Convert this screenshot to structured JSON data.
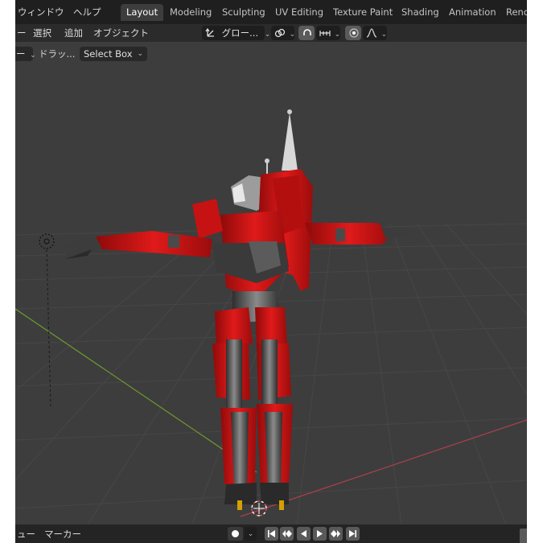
{
  "top_menu": {
    "window": "ウィンドウ",
    "help": "ヘルプ"
  },
  "workspace_tabs": [
    {
      "label": "Layout",
      "active": true
    },
    {
      "label": "Modeling",
      "active": false
    },
    {
      "label": "Sculpting",
      "active": false
    },
    {
      "label": "UV Editing",
      "active": false
    },
    {
      "label": "Texture Paint",
      "active": false
    },
    {
      "label": "Shading",
      "active": false
    },
    {
      "label": "Animation",
      "active": false
    },
    {
      "label": "Rende",
      "active": false
    }
  ],
  "header": {
    "view_fragment": "ー",
    "select": "選択",
    "add": "追加",
    "object": "オブジェクト",
    "transform_orientation": "グロー...",
    "chevron": "⌄"
  },
  "tool_header": {
    "mode_fragment": "ー",
    "drag_label": "ドラッ...",
    "select_mode": "Select Box"
  },
  "timeline": {
    "view_fragment": "ュー",
    "marker": "マーカー"
  },
  "icons": [
    "transform-orientation-icon",
    "pivot-icon",
    "snap-icon",
    "snap-increment-icon",
    "proportional-edit-icon",
    "falloff-icon",
    "record-icon",
    "jump-start-icon",
    "prev-keyframe-icon",
    "play-reverse-icon",
    "play-icon",
    "next-keyframe-icon",
    "jump-end-icon",
    "light-icon",
    "origin-icon"
  ],
  "colors": {
    "topbar": "#1f1f1f",
    "header": "#2b2b2b",
    "viewport_bg": "#3d3d3d",
    "grid_line": "#464646",
    "x_axis": "#b0404e",
    "y_axis": "#6f9a2e",
    "robot_red": "#d21414",
    "robot_gray": "#5a5a5a"
  }
}
